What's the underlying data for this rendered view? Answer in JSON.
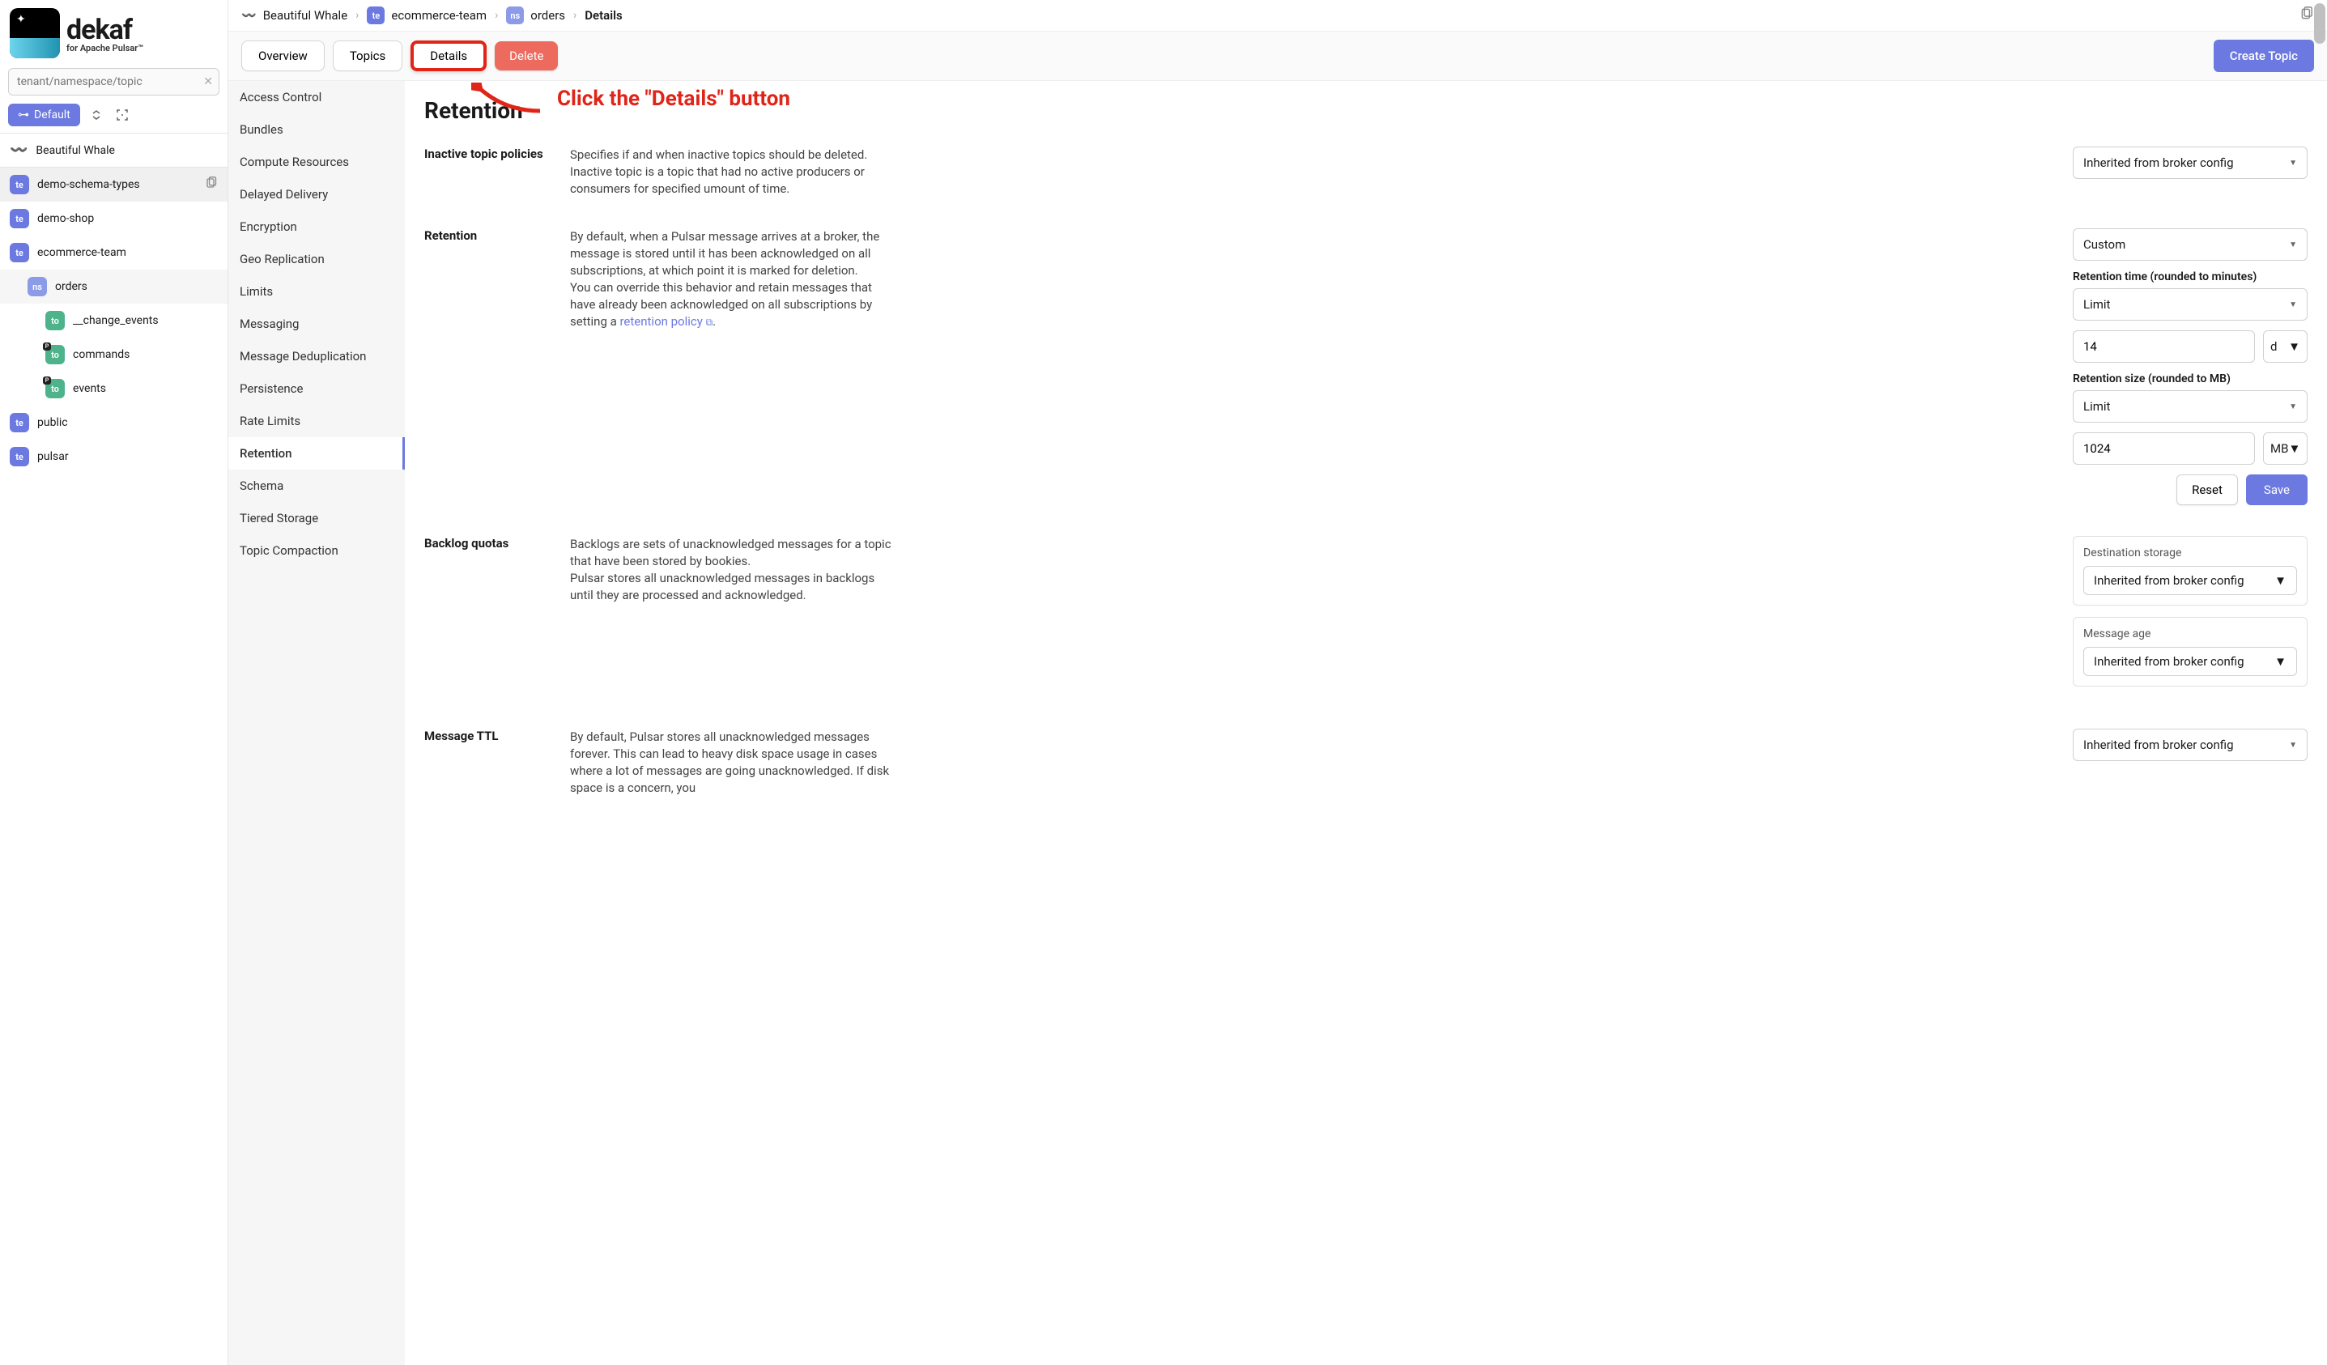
{
  "brand": {
    "title": "dekaf",
    "subtitle": "for Apache Pulsar™"
  },
  "sidebar": {
    "search_placeholder": "tenant/namespace/topic",
    "default_label": "Default",
    "instance": "Beautiful Whale",
    "tree": {
      "demo_schema": "demo-schema-types",
      "demo_shop": "demo-shop",
      "ecommerce": "ecommerce-team",
      "orders": "orders",
      "change_events": "__change_events",
      "commands": "commands",
      "events": "events",
      "public": "public",
      "pulsar": "pulsar"
    }
  },
  "breadcrumb": {
    "root": "Beautiful Whale",
    "tenant_badge": "te",
    "tenant": "ecommerce-team",
    "ns_badge": "ns",
    "namespace": "orders",
    "current": "Details"
  },
  "tabs": {
    "overview": "Overview",
    "topics": "Topics",
    "details": "Details",
    "delete": "Delete",
    "create": "Create Topic"
  },
  "annotation": "Click the \"Details\"  button",
  "sidenav": {
    "items": [
      "Access Control",
      "Bundles",
      "Compute Resources",
      "Delayed Delivery",
      "Encryption",
      "Geo Replication",
      "Limits",
      "Messaging",
      "Message Deduplication",
      "Persistence",
      "Rate Limits",
      "Retention",
      "Schema",
      "Tiered Storage",
      "Topic Compaction"
    ],
    "active": "Retention"
  },
  "page": {
    "title": "Retention",
    "inactive": {
      "label": "Inactive topic policies",
      "desc": "Specifies if and when inactive topics should be deleted. Inactive topic is a topic that had no active producers or consumers for specified umount of time.",
      "select": "Inherited from broker config"
    },
    "retention": {
      "label": "Retention",
      "desc_a": "By default, when a Pulsar message arrives at a broker, the message is stored until it has been acknowledged on all subscriptions, at which point it is marked for deletion.",
      "desc_b": "You can override this behavior and retain messages that have already been acknowledged on all subscriptions by setting a ",
      "link": "retention policy",
      "select_mode": "Custom",
      "time_label": "Retention time (rounded to minutes)",
      "time_mode": "Limit",
      "time_val": "14",
      "time_unit": "d",
      "size_label": "Retention size (rounded to MB)",
      "size_mode": "Limit",
      "size_val": "1024",
      "size_unit": "MB",
      "reset": "Reset",
      "save": "Save"
    },
    "backlog": {
      "label": "Backlog quotas",
      "desc_a": "Backlogs are sets of unacknowledged messages for a topic that have been stored by bookies.",
      "desc_b": "Pulsar stores all unacknowledged messages in backlogs until they are processed and acknowledged.",
      "dest_label": "Destination storage",
      "dest_select": "Inherited from broker config",
      "age_label": "Message age",
      "age_select": "Inherited from broker config"
    },
    "ttl": {
      "label": "Message TTL",
      "desc": "By default, Pulsar stores all unacknowledged messages forever. This can lead to heavy disk space usage in cases where a lot of messages are going unacknowledged. If disk space is a concern, you",
      "select": "Inherited from broker config"
    }
  }
}
